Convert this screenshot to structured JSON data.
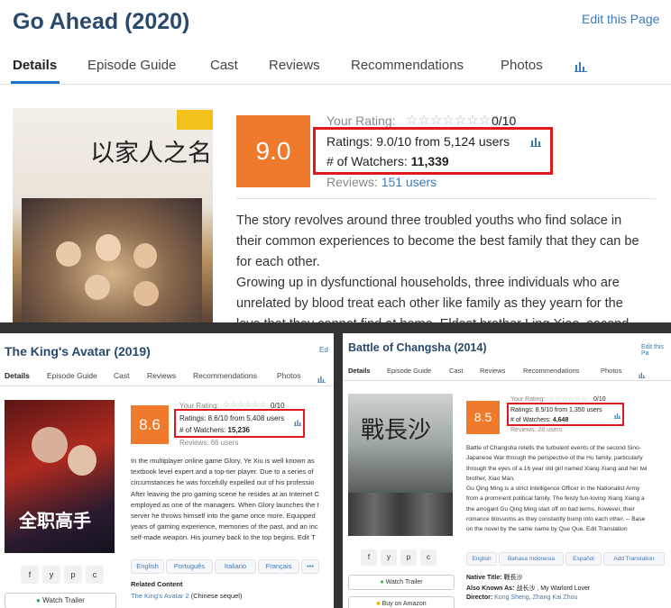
{
  "top": {
    "title": "Go Ahead (2020)",
    "edit_link": "Edit this Page",
    "tabs": [
      "Details",
      "Episode Guide",
      "Cast",
      "Reviews",
      "Recommendations",
      "Photos"
    ],
    "score": "9.0",
    "your_rating_label": "Your Rating:",
    "your_rating_value": "0/10",
    "ratings": "Ratings: 9.0/10 from 5,124 users",
    "watchers_label": "# of Watchers:",
    "watchers_value": "11,339",
    "reviews_label": "Reviews:",
    "reviews_value": "151 users",
    "poster_text": "以家人之名",
    "description": [
      "The story revolves around three troubled youths who find solace in",
      "their common experiences to become the best family that they can be",
      "for each other.",
      "Growing up in dysfunctional households, three individuals who are",
      "unrelated by blood treat each other like family as they yearn for the",
      "love that they cannot find at home. Eldest brother Ling Xiao, second"
    ]
  },
  "left": {
    "title": "The King's Avatar (2019)",
    "edit_link": "Ed",
    "tabs": [
      "Details",
      "Episode Guide",
      "Cast",
      "Reviews",
      "Recommendations",
      "Photos"
    ],
    "score": "8.6",
    "your_rating_label": "Your Rating:",
    "your_rating_value": "0/10",
    "ratings": "Ratings: 8.6/10 from 5,408 users",
    "watchers_label": "# of Watchers:",
    "watchers_value": "15,236",
    "reviews_label": "Reviews:",
    "reviews_value": "66 users",
    "poster_text": "全职高手",
    "description": [
      "In the multiplayer online game Glory, Ye Xiu is well known as",
      "textbook level expert and a top-tier player. Due to a series of",
      "circumstances he was forcefully expelled out of his professio",
      "After leaving the pro gaming scene he resides at an Internet C",
      "employed as one of the managers. When Glory launches the t",
      "server he throws himself into the game once more. Equipped",
      "years of gaming experience, memories of the past, and an inc",
      "self-made weapon. His journey back to the top begins. Edit T"
    ],
    "languages": [
      "English",
      "Português",
      "Italiano",
      "Français",
      "•••"
    ],
    "watch_trailer": "Watch Trailer",
    "related_label": "Related Content",
    "related_link": "The King's Avatar 2",
    "related_suffix": "(Chinese sequel)",
    "social": [
      "f",
      "y",
      "p",
      "c"
    ]
  },
  "right": {
    "title": "Battle of Changsha (2014)",
    "edit_link": "Edit this Pa",
    "tabs": [
      "Details",
      "Episode Guide",
      "Cast",
      "Reviews",
      "Recommendations",
      "Photos"
    ],
    "score": "8.5",
    "your_rating_label": "Your Rating:",
    "your_rating_value": "0/10",
    "ratings": "Ratings: 8.5/10 from 1,350 users",
    "watchers_label": "# of Watchers:",
    "watchers_value": "4,648",
    "reviews_label": "Reviews:",
    "reviews_value": "28 users",
    "poster_text": "戰長沙",
    "description": [
      "Battle of Changsha retells the turbulent events of the second Sino-",
      "Japanese War through the perspective of the Hu family, particularly",
      "through the eyes of a 16 year old girl named Xiang Xiang and her twi",
      "brother, Xiao Man.",
      "Gu Qing Ming is a strict Intelligence Officer in the Nationalist Army",
      "from a prominent political family. The feisty fun-loving Xiang Xiang a",
      "the arrogant Gu Qing Ming start off on bad terms, however, their",
      "romance blossoms as they constantly bump into each other. -- Base",
      "on the novel by the same name by Que Que. Edit Translation"
    ],
    "languages": [
      "English",
      "Bahasa Indonesia",
      "Español",
      "Add Translation"
    ],
    "watch_trailer": "Watch Trailer",
    "buy_amazon": "Buy on Amazon",
    "native_title_label": "Native Title:",
    "native_title_value": "戰長沙",
    "also_known_label": "Also Known As:",
    "also_known_value": "战长沙 , My Warlord Lover",
    "director_label": "Director:",
    "director_value": "Kong Sheng, Zhang Kai Zhou",
    "social": [
      "f",
      "y",
      "p",
      "c"
    ]
  },
  "colors": {
    "score_bg": "#f07a2b",
    "highlight_box": "#e0181b",
    "link": "#3d7ab8",
    "title": "#2a4a6b"
  }
}
